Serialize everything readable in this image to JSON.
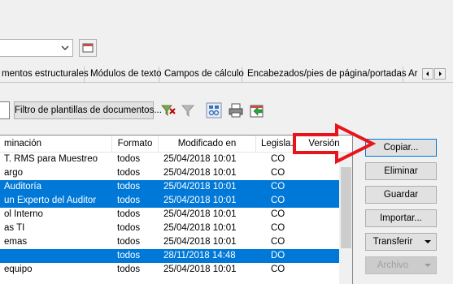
{
  "tabs": [
    {
      "label": "mentos estructurales"
    },
    {
      "label": "Módulos de texto"
    },
    {
      "label": "Campos de cálculo"
    },
    {
      "label": "Encabezados/pies de página/portadas"
    },
    {
      "label": "Ar"
    }
  ],
  "filter": {
    "button_label": "Filtro de plantillas de documentos..."
  },
  "list": {
    "columns": [
      "minación",
      "Formato",
      "Modificado en",
      "Legisla...",
      "Versión"
    ],
    "rows": [
      {
        "name": "T. RMS para Muestreo",
        "format": "todos",
        "modified": "25/04/2018 10:01",
        "legis": "CO",
        "selected": false
      },
      {
        "name": "argo",
        "format": "todos",
        "modified": "25/04/2018 10:01",
        "legis": "CO",
        "selected": false
      },
      {
        "name": "Auditoría",
        "format": "todos",
        "modified": "25/04/2018 10:01",
        "legis": "CO",
        "selected": true
      },
      {
        "name": "un Experto del Auditor",
        "format": "todos",
        "modified": "25/04/2018 10:01",
        "legis": "CO",
        "selected": true
      },
      {
        "name": "ol Interno",
        "format": "todos",
        "modified": "25/04/2018 10:01",
        "legis": "CO",
        "selected": false
      },
      {
        "name": "as TI",
        "format": "todos",
        "modified": "25/04/2018 10:01",
        "legis": "CO",
        "selected": false
      },
      {
        "name": "emas",
        "format": "todos",
        "modified": "25/04/2018 10:01",
        "legis": "CO",
        "selected": false
      },
      {
        "name": "",
        "format": "todos",
        "modified": "28/11/2018 14:48",
        "legis": "DO",
        "selected": true
      },
      {
        "name": "equipo",
        "format": "todos",
        "modified": "25/04/2018 10:01",
        "legis": "CO",
        "selected": false
      }
    ]
  },
  "actions": {
    "copy": "Copiar...",
    "delete": "Eliminar",
    "save": "Guardar",
    "import": "Importar...",
    "transfer": "Transferir",
    "file": "Archivo"
  },
  "colors": {
    "selection": "#0078d7",
    "annotation_arrow": "#e8141c"
  },
  "icons": [
    "dropdown-arrow-icon",
    "template-browse-icon",
    "scroll-left-icon",
    "scroll-right-icon",
    "filter-active-icon",
    "filter-icon",
    "network-icon",
    "print-icon",
    "export-icon",
    "red-arrow-annotation"
  ]
}
